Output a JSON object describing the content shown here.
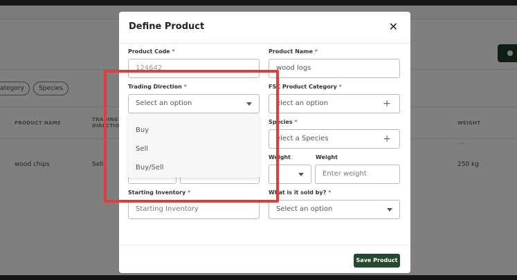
{
  "background": {
    "chips": [
      "ategory",
      "Species"
    ],
    "table_headers": [
      "PRODUCT NAME",
      "TRADING DIRECTION",
      "WEIGHT"
    ],
    "row_dash": "---",
    "row": {
      "product_name": "wood chips",
      "direction": "Sell",
      "weight": "250 kg"
    }
  },
  "modal": {
    "title": "Define Product",
    "close_glyph": "✕",
    "product_code": {
      "label": "Product Code",
      "value": "124642"
    },
    "product_name": {
      "label": "Product Name",
      "value": "wood logs"
    },
    "trading_direction": {
      "label": "Trading Direction",
      "placeholder": "Select an option",
      "options": [
        "Buy",
        "Sell",
        "Buy/Sell"
      ]
    },
    "fsc_category": {
      "label": "FSC Product Category",
      "placeholder": "elect an option"
    },
    "species": {
      "label": "Species",
      "placeholder": "elect a Species"
    },
    "weight": {
      "label_left": "Weight",
      "label_right": "Weight",
      "placeholder": "Enter weight"
    },
    "starting_inventory": {
      "label": "Starting Inventory",
      "placeholder": "Starting Inventory"
    },
    "sold_by": {
      "label": "What is it sold by?",
      "placeholder": "Select an option"
    },
    "required_mark": "*",
    "save_label": "Save Product"
  },
  "colors": {
    "brand_green": "#234a30",
    "highlight": "#e43c3c",
    "required": "#c75a3b"
  }
}
